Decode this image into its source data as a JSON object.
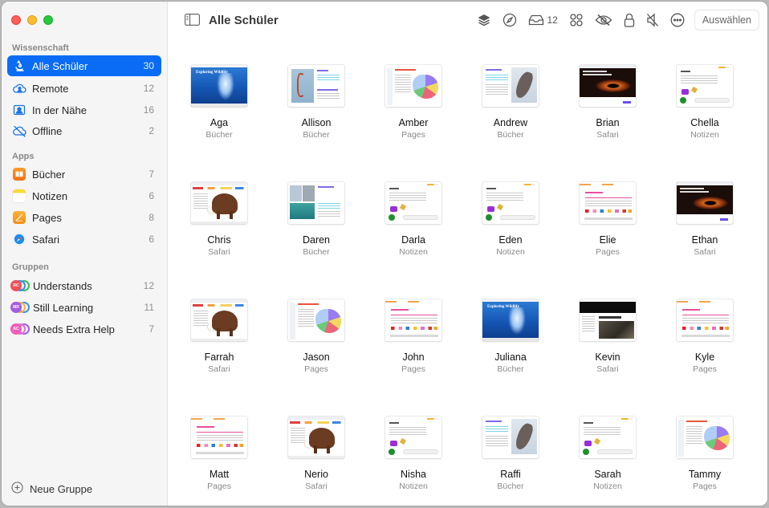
{
  "window": {
    "title": "Alle Schüler"
  },
  "sidebar": {
    "sections": [
      {
        "label": "Wissenschaft",
        "items": [
          {
            "label": "Alle Schüler",
            "count": "30",
            "icon": "microscope-icon",
            "active": true
          },
          {
            "label": "Remote",
            "count": "12",
            "icon": "cloud-person-icon"
          },
          {
            "label": "In der Nähe",
            "count": "16",
            "icon": "person-frame-icon"
          },
          {
            "label": "Offline",
            "count": "2",
            "icon": "cloud-slash-icon"
          }
        ]
      },
      {
        "label": "Apps",
        "items": [
          {
            "label": "Bücher",
            "count": "7",
            "icon": "books-app-icon",
            "color": "#f7851c"
          },
          {
            "label": "Notizen",
            "count": "6",
            "icon": "notes-app-icon",
            "color": "#fddb3a"
          },
          {
            "label": "Pages",
            "count": "8",
            "icon": "pages-app-icon",
            "color": "#f8a01a"
          },
          {
            "label": "Safari",
            "count": "6",
            "icon": "safari-app-icon",
            "color": "#1d8cf0"
          }
        ]
      },
      {
        "label": "Gruppen",
        "items": [
          {
            "label": "Understands",
            "count": "12",
            "icon": "group-icon",
            "initials": "RC",
            "colors": [
              "#f0505a",
              "#3a8ef6",
              "#33c25a"
            ]
          },
          {
            "label": "Still Learning",
            "count": "11",
            "icon": "group-icon",
            "initials": "MR",
            "colors": [
              "#a45de0",
              "#f2b53a",
              "#3a8ef6"
            ]
          },
          {
            "label": "Needs Extra Help",
            "count": "7",
            "icon": "group-icon",
            "initials": "AC",
            "colors": [
              "#ee5fb8",
              "#e86fd6",
              "#9b62e8"
            ]
          }
        ]
      }
    ],
    "new_group_label": "Neue Gruppe"
  },
  "toolbar": {
    "title": "Alle Schüler",
    "inbox_count": "12",
    "select_label": "Auswählen",
    "icons": [
      "layers-icon",
      "compass-icon",
      "inbox-icon",
      "apps-grid-icon",
      "eye-slash-icon",
      "lock-icon",
      "mute-icon",
      "more-icon"
    ]
  },
  "students": [
    {
      "name": "Aga",
      "app": "Bücher",
      "thumb": "books-wild"
    },
    {
      "name": "Allison",
      "app": "Bücher",
      "thumb": "books-flam"
    },
    {
      "name": "Amber",
      "app": "Pages",
      "thumb": "pages-map"
    },
    {
      "name": "Andrew",
      "app": "Bücher",
      "thumb": "books-bird"
    },
    {
      "name": "Brian",
      "app": "Safari",
      "thumb": "safari-hole"
    },
    {
      "name": "Chella",
      "app": "Notizen",
      "thumb": "notes"
    },
    {
      "name": "Chris",
      "app": "Safari",
      "thumb": "safari-mam"
    },
    {
      "name": "Daren",
      "app": "Bücher",
      "thumb": "books-two"
    },
    {
      "name": "Darla",
      "app": "Notizen",
      "thumb": "notes"
    },
    {
      "name": "Eden",
      "app": "Notizen",
      "thumb": "notes"
    },
    {
      "name": "Elie",
      "app": "Pages",
      "thumb": "pages-inv"
    },
    {
      "name": "Ethan",
      "app": "Safari",
      "thumb": "safari-hole"
    },
    {
      "name": "Farrah",
      "app": "Safari",
      "thumb": "safari-mam"
    },
    {
      "name": "Jason",
      "app": "Pages",
      "thumb": "pages-map"
    },
    {
      "name": "John",
      "app": "Pages",
      "thumb": "pages-inv"
    },
    {
      "name": "Juliana",
      "app": "Bücher",
      "thumb": "books-wild"
    },
    {
      "name": "Kevin",
      "app": "Safari",
      "thumb": "safari-shak"
    },
    {
      "name": "Kyle",
      "app": "Pages",
      "thumb": "pages-inv"
    },
    {
      "name": "Matt",
      "app": "Pages",
      "thumb": "pages-inv"
    },
    {
      "name": "Nerio",
      "app": "Safari",
      "thumb": "safari-mam"
    },
    {
      "name": "Nisha",
      "app": "Notizen",
      "thumb": "notes"
    },
    {
      "name": "Raffi",
      "app": "Bücher",
      "thumb": "books-bird"
    },
    {
      "name": "Sarah",
      "app": "Notizen",
      "thumb": "notes"
    },
    {
      "name": "Tammy",
      "app": "Pages",
      "thumb": "pages-map"
    }
  ],
  "thumb_texts": {
    "books-wild": "Exploring Wildlife",
    "safari-shak": "Shakespeare's Life"
  },
  "colors": {
    "accent": "#0a6cf5",
    "sidebar_bg": "#f5f5f5"
  }
}
